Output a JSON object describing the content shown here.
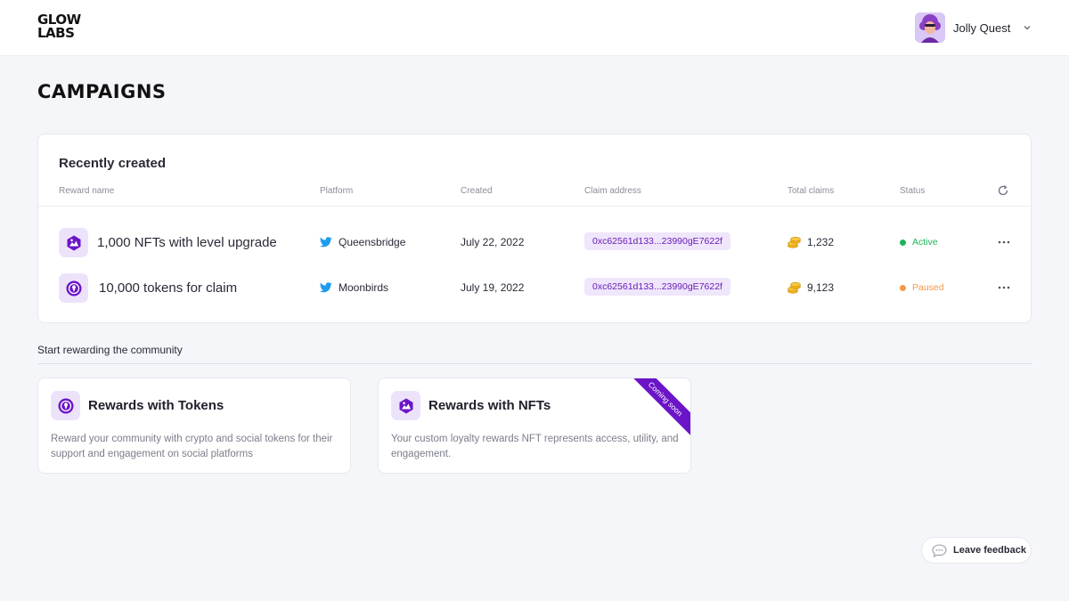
{
  "header": {
    "logo_line1": "GLOW",
    "logo_line2": "LABS",
    "user_name": "Jolly Quest"
  },
  "page_title": "CAMPAIGNS",
  "recent": {
    "title": "Recently created",
    "columns": {
      "reward_name": "Reward name",
      "platform": "Platform",
      "created": "Created",
      "claim_address": "Claim address",
      "total_claims": "Total claims",
      "status": "Status"
    },
    "rows": [
      {
        "icon": "nft-icon",
        "name": "1,000 NFTs with level upgrade",
        "platform": "Queensbridge",
        "created": "July 22, 2022",
        "address": "0xc62561d133...23990gE7622f",
        "claims": "1,232",
        "status": "Active",
        "status_color": "#1fb35a"
      },
      {
        "icon": "token-icon",
        "name": "10,000 tokens for claim",
        "platform": "Moonbirds",
        "created": "July 19, 2022",
        "address": "0xc62561d133...23990gE7622f",
        "claims": "9,123",
        "status": "Paused",
        "status_color": "#f39a4a"
      }
    ]
  },
  "community": {
    "title": "Start rewarding the community",
    "cards": [
      {
        "icon": "token-icon",
        "title": "Rewards with Tokens",
        "description": "Reward your community with crypto and social tokens for their support and engagement on social platforms"
      },
      {
        "icon": "nft-icon",
        "title": "Rewards with NFTs",
        "description": "Your custom loyalty rewards NFT represents access, utility, and engagement.",
        "ribbon": "Coming soon"
      }
    ]
  },
  "feedback_label": "Leave feedback",
  "colors": {
    "accent": "#6b14c8",
    "accent_light": "#ece3fb",
    "twitter": "#1d9bf0",
    "coin": "#f2b51c"
  }
}
